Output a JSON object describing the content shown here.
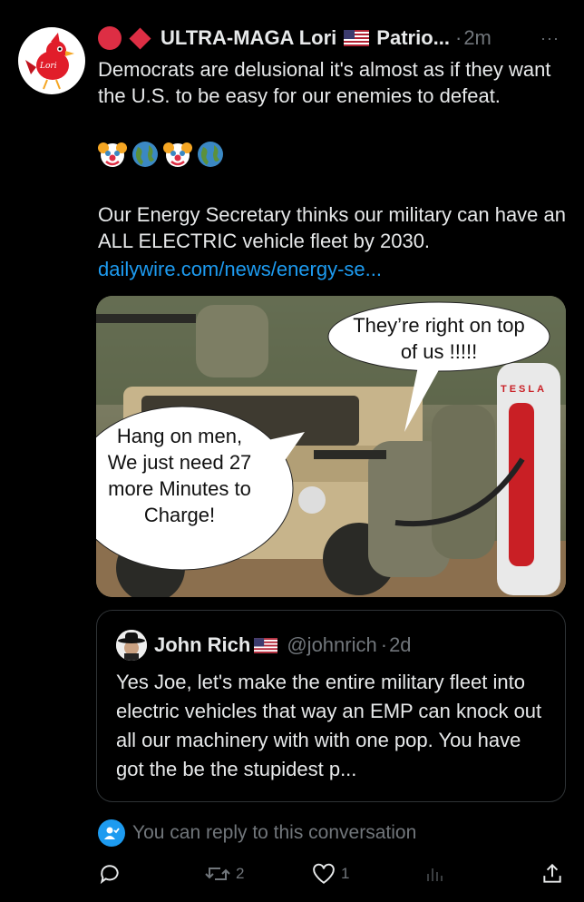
{
  "tweet": {
    "author_name": "ULTRA-MAGA Lori",
    "author_suffix": "Patrio...",
    "separator": "·",
    "time": "2m",
    "more": "···",
    "text": "Democrats are delusional it's almost as if they want the U.S. to be easy for our enemies to defeat.",
    "emojis": [
      "clown-face",
      "globe",
      "clown-face",
      "globe"
    ],
    "paragraph2": "Our Energy Secretary thinks our military can have an ALL ELECTRIC vehicle fleet by 2030.",
    "link": "dailywire.com/news/energy-se...",
    "avatar_label": "Lori"
  },
  "meme": {
    "bubble_top": "They’re right on top of us !!!!!",
    "bubble_left": "Hang on men, We just need 27 more Minutes to Charge!",
    "charger_brand": "TESLA"
  },
  "quote": {
    "name": "John Rich",
    "handle": "@johnrich",
    "separator": "·",
    "time": "2d",
    "text": "Yes Joe, let's make the entire military fleet into electric vehicles that way an EMP can knock out all our machinery with with one pop. You have got the be the stupidest p..."
  },
  "reply_note": "You can reply to this conversation",
  "actions": {
    "reply_count": "",
    "retweet_count": "2",
    "like_count": "1"
  },
  "colors": {
    "background": "#000000",
    "text": "#e7e9ea",
    "muted": "#71767b",
    "link": "#1d9bf0",
    "border": "#2f3336",
    "red": "#dd2e44"
  }
}
